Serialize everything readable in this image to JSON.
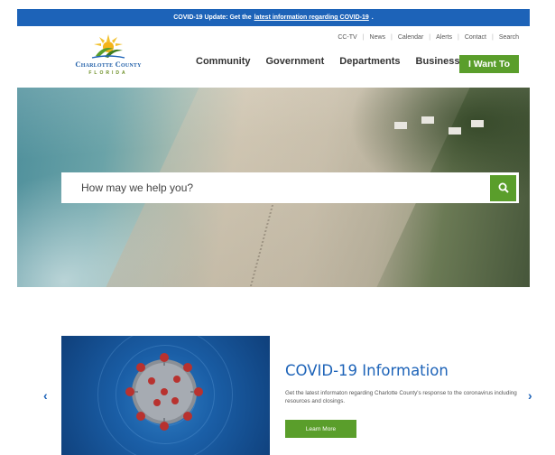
{
  "alert": {
    "prefix": "COVID-19 Update: Get the",
    "link": "latest information regarding COVID-19",
    "suffix": "."
  },
  "utility_nav": [
    "CC-TV",
    "News",
    "Calendar",
    "Alerts",
    "Contact",
    "Search"
  ],
  "logo": {
    "name": "Charlotte County",
    "sub": "FLORIDA"
  },
  "main_nav": [
    "Community",
    "Government",
    "Departments",
    "Business"
  ],
  "cta_button": "I Want To",
  "search": {
    "placeholder": "How may we help you?",
    "icon": "search-icon"
  },
  "slide": {
    "title": "COVID-19 Information",
    "text": "Get the latest informaton regarding Charlotte County's response to the coronavirus including resources and closings.",
    "button": "Learn More"
  },
  "colors": {
    "brand_blue": "#1d63b8",
    "brand_green": "#5a9e2b"
  }
}
